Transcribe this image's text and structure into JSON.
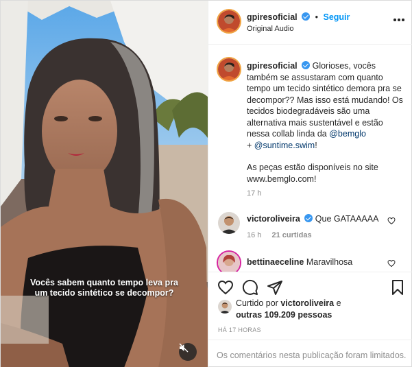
{
  "video": {
    "caption_line1": "Vocês sabem quanto tempo leva pra",
    "caption_line2": "um tecido sintético se decompor?",
    "mute_icon": "speaker-muted-icon"
  },
  "header": {
    "username": "gpiresoficial",
    "separator": "•",
    "follow_label": "Seguir",
    "audio_label": "Original Audio",
    "more_icon": "more-options-icon"
  },
  "post_caption": {
    "username": "gpiresoficial",
    "text_1": "Glorioses, vocês também se assustaram com quanto tempo um tecido sintético demora pra se decompor?? Mas isso está mudando! Os tecidos biodegradáveis são uma alternativa mais sustentável e estão nessa collab linda da ",
    "mention_1": "@bemglo",
    "text_2": " + ",
    "mention_2": "@suntime.swim",
    "text_3": "!",
    "text_4": "As peças estão disponíveis no site www.bemglo.com!",
    "time": "17 h"
  },
  "comments": [
    {
      "username": "victoroliveira",
      "text": "Que GATAAAAA",
      "time": "16 h",
      "likes": "21 curtidas"
    },
    {
      "username": "bettinaeceline",
      "text": "Maravilhosa"
    }
  ],
  "actions": {
    "like_icon": "heart-icon",
    "comment_icon": "comment-icon",
    "share_icon": "paper-plane-icon",
    "save_icon": "bookmark-icon"
  },
  "likes": {
    "prefix": "Curtido por ",
    "user": "victoroliveira",
    "suffix": " e",
    "others": "outras 109.209 pessoas"
  },
  "time_ago": "HÁ 17 HORAS",
  "limited_text": "Os comentários nesta publicação foram limitados."
}
